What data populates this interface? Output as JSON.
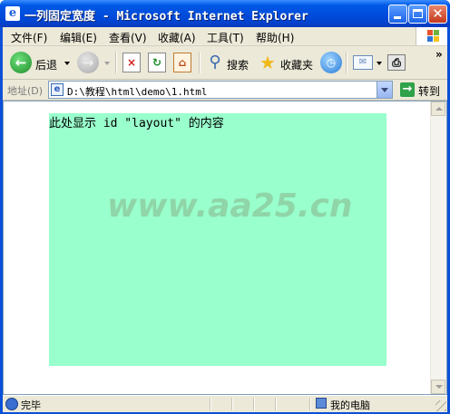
{
  "window": {
    "title": "一列固定宽度 - Microsoft Internet Explorer",
    "icon": "ie-page-icon"
  },
  "menu": {
    "items": [
      {
        "label": "文件(F)"
      },
      {
        "label": "编辑(E)"
      },
      {
        "label": "查看(V)"
      },
      {
        "label": "收藏(A)"
      },
      {
        "label": "工具(T)"
      },
      {
        "label": "帮助(H)"
      }
    ]
  },
  "toolbar": {
    "back_label": "后退",
    "search_label": "搜索",
    "favorites_label": "收藏夹",
    "overflow": "»"
  },
  "address": {
    "label": "地址(D)",
    "value": "D:\\教程\\html\\demo\\1.html",
    "go_label": "转到"
  },
  "page": {
    "layout_text": "此处显示 id \"layout\" 的内容",
    "layout_bg": "#99ffcc",
    "watermark": "www.aa25.cn"
  },
  "status": {
    "text": "完毕",
    "zone": "我的电脑"
  },
  "colors": {
    "titlebar": "#0058e6",
    "chrome": "#ece9d8"
  }
}
